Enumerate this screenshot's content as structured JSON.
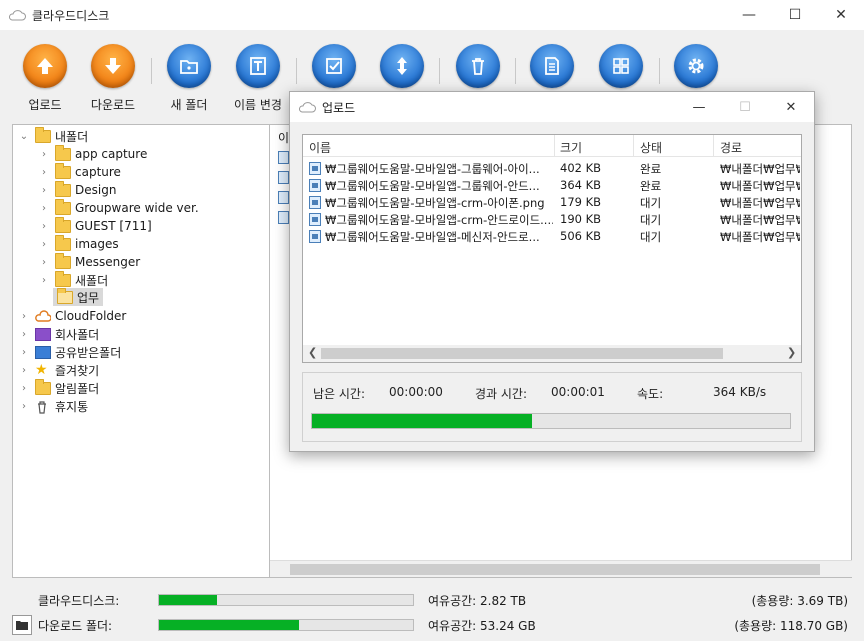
{
  "window": {
    "title": "클라우드디스크",
    "minimize": "—",
    "maximize": "☐",
    "close": "✕"
  },
  "toolbar": [
    {
      "name": "upload-button",
      "label": "업로드",
      "color": "orange",
      "icon": "arrow-up-icon"
    },
    {
      "name": "download-button",
      "label": "다운로드",
      "color": "orange",
      "icon": "arrow-down-icon"
    },
    {
      "name": "new-folder-button",
      "label": "새 폴더",
      "color": "blue",
      "icon": "folder-star-icon"
    },
    {
      "name": "rename-button",
      "label": "이름 변경",
      "color": "blue",
      "icon": "text-icon"
    },
    {
      "name": "select-all-button",
      "label": "",
      "color": "blue",
      "icon": "checkbox-icon"
    },
    {
      "name": "move-button",
      "label": "",
      "color": "blue",
      "icon": "updown-arrow-icon"
    },
    {
      "name": "delete-button",
      "label": "",
      "color": "blue",
      "icon": "trash-icon"
    },
    {
      "name": "properties-button",
      "label": "",
      "color": "blue",
      "icon": "document-icon"
    },
    {
      "name": "view-button",
      "label": "",
      "color": "blue",
      "icon": "grid-icon"
    },
    {
      "name": "settings-button",
      "label": "",
      "color": "blue",
      "icon": "gear-icon"
    }
  ],
  "tree": {
    "root": "내폴더",
    "children": [
      "app capture",
      "capture",
      "Design",
      "Groupware wide ver.",
      "GUEST [711]",
      "images",
      "Messenger",
      "새폴더",
      "업무"
    ],
    "others": [
      "CloudFolder",
      "회사폴더",
      "공유받은폴더",
      "즐겨찾기",
      "알림폴더",
      "휴지통"
    ]
  },
  "right_panel": {
    "header_fragment": "이"
  },
  "upload_dialog": {
    "title": "업로드",
    "columns": {
      "name": "이름",
      "size": "크기",
      "status": "상태",
      "path": "경로"
    },
    "rows": [
      {
        "name": "₩그룹웨어도움말-모바일앱-그룹웨어-아이...",
        "size": "402 KB",
        "status": "완료",
        "path": "₩내폴더₩업무₩"
      },
      {
        "name": "₩그룹웨어도움말-모바일앱-그룹웨어-안드...",
        "size": "364 KB",
        "status": "완료",
        "path": "₩내폴더₩업무₩"
      },
      {
        "name": "₩그룹웨어도움말-모바일앱-crm-아이폰.png",
        "size": "179 KB",
        "status": "대기",
        "path": "₩내폴더₩업무₩"
      },
      {
        "name": "₩그룹웨어도움말-모바일앱-crm-안드로이드....",
        "size": "190 KB",
        "status": "대기",
        "path": "₩내폴더₩업무₩"
      },
      {
        "name": "₩그룹웨어도움말-모바일앱-메신저-안드로...",
        "size": "506 KB",
        "status": "대기",
        "path": "₩내폴더₩업무₩"
      }
    ],
    "remaining_label": "남은 시간:",
    "remaining_value": "00:00:00",
    "elapsed_label": "경과 시간:",
    "elapsed_value": "00:00:01",
    "speed_label": "속도:",
    "speed_value": "364 KB/s",
    "progress": 0.46
  },
  "footer": {
    "cloud_label": "클라우드디스크:",
    "cloud_usage": 0.23,
    "cloud_free": "여유공간: 2.82 TB",
    "cloud_total": "(총용량: 3.69 TB)",
    "download_label": "다운로드 폴더:",
    "download_usage": 0.55,
    "download_free": "여유공간: 53.24 GB",
    "download_total": "(총용량: 118.70 GB)"
  }
}
